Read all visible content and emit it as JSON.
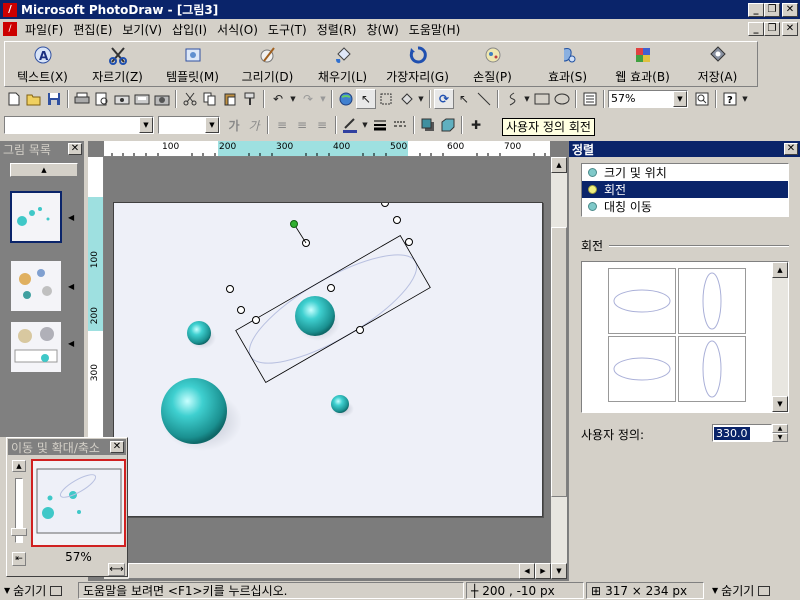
{
  "window": {
    "title": "Microsoft PhotoDraw - [그림3]",
    "icon_letter": "/"
  },
  "menubar": {
    "items": [
      "파일(F)",
      "편집(E)",
      "보기(V)",
      "삽입(I)",
      "서식(O)",
      "도구(T)",
      "정렬(R)",
      "창(W)",
      "도움말(H)"
    ]
  },
  "big_toolbar": {
    "buttons": [
      {
        "label": "텍스트(X)",
        "icon": "text-icon"
      },
      {
        "label": "자르기(Z)",
        "icon": "scissors-icon"
      },
      {
        "label": "템플릿(M)",
        "icon": "template-icon"
      },
      {
        "label": "그리기(D)",
        "icon": "draw-icon"
      },
      {
        "label": "채우기(L)",
        "icon": "fill-icon"
      },
      {
        "label": "가장자리(G)",
        "icon": "outline-icon"
      },
      {
        "label": "손질(P)",
        "icon": "touchup-icon"
      },
      {
        "label": "효과(S)",
        "icon": "effects-icon"
      },
      {
        "label": "웹 효과(B)",
        "icon": "web-effects-icon"
      },
      {
        "label": "저장(A)",
        "icon": "save-icon"
      }
    ]
  },
  "standard_toolbar": {
    "zoom": "57%"
  },
  "format_toolbar": {
    "bold": "가",
    "italic": "가"
  },
  "tooltip": {
    "text": "사용자 정의 회전"
  },
  "picture_list": {
    "title": "그림 목록"
  },
  "canvas": {
    "hruler_labels": [
      "100",
      "200",
      "300",
      "400",
      "500",
      "600",
      "700"
    ],
    "vruler_labels": [
      "100",
      "200",
      "300"
    ]
  },
  "pan_zoom": {
    "title": "이동 및 확대/축소",
    "zoom": "57%"
  },
  "arrange_panel": {
    "title": "정렬",
    "options": [
      "크기 및 위치",
      "회전",
      "대칭 이동"
    ],
    "selected_index": 1,
    "section_label": "회전",
    "custom_label": "사용자 정의:",
    "custom_value": "330.0"
  },
  "statusbar": {
    "hide_left": "숨기기",
    "help": "도움말을 보려면 <F1>키를 누르십시오.",
    "position": "200 , -10  px",
    "size": "317 × 234  px",
    "hide_right": "숨기기"
  },
  "colors": {
    "titlebar": "#0a246a",
    "sphere": "#3fc8c8",
    "selection": "#000080"
  }
}
